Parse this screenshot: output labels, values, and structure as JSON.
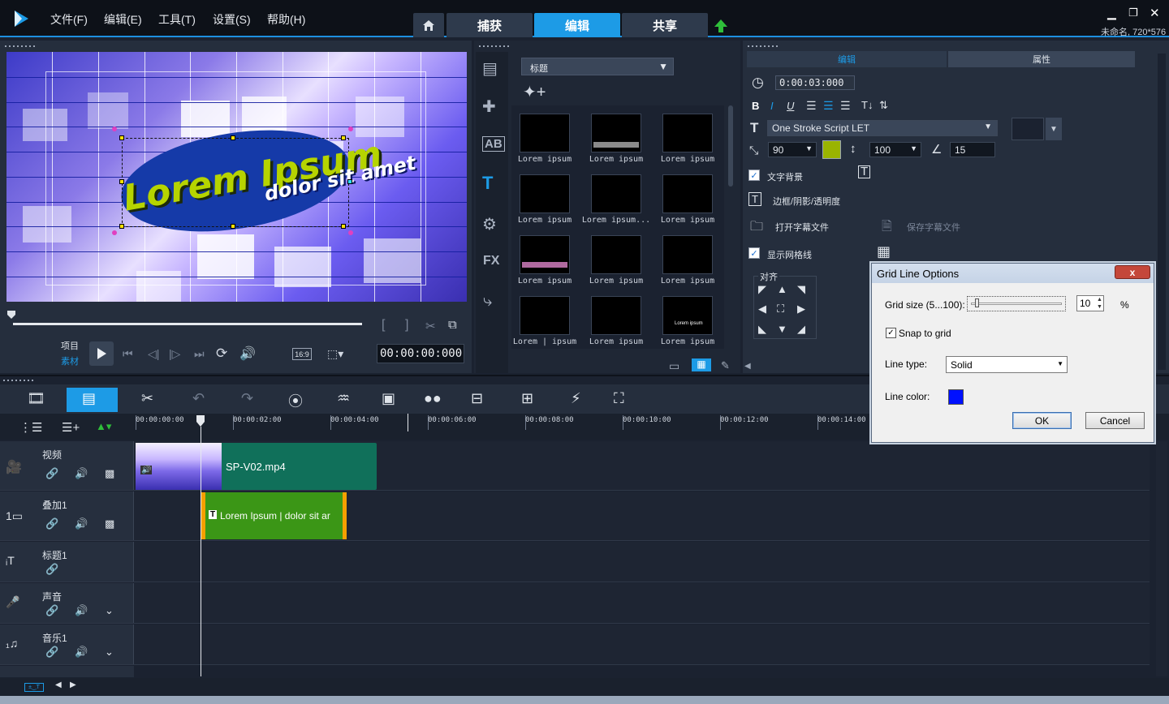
{
  "app": {
    "menu": [
      "文件(F)",
      "编辑(E)",
      "工具(T)",
      "设置(S)",
      "帮助(H)"
    ],
    "tabs": [
      "捕获",
      "编辑",
      "共享"
    ],
    "active_tab": "编辑",
    "project_info": "未命名, 720*576",
    "accent": "#1d9be6"
  },
  "preview": {
    "title_text_1": "Lorem Ipsum",
    "title_text_2": "dolor sit amet",
    "mode_project": "项目",
    "mode_clip": "素材",
    "aspect": "16:9",
    "timecode": "00:00:00:000"
  },
  "library": {
    "category": "标题",
    "items": [
      "Lorem ipsum",
      "Lorem ipsum",
      "Lorem ipsum",
      "Lorem ipsum",
      "Lorem ipsum...",
      "Lorem ipsum",
      "Lorem ipsum",
      "Lorem ipsum",
      "Lorem ipsum",
      "Lorem | ipsum",
      "Lorem ipsum",
      "Lorem ipsum"
    ],
    "fx_label": "FX",
    "thumb_mini_text": "Lorem ipsum"
  },
  "options": {
    "tab_edit": "编辑",
    "tab_attr": "属性",
    "duration": "0:00:03:000",
    "font": "One Stroke Script LET",
    "font_size": "90",
    "line_spacing": "100",
    "angle": "15",
    "text_color": "#9ab400",
    "text_bg_label": "文字背景",
    "border_label": "边框/阴影/透明度",
    "open_subtitle": "打开字幕文件",
    "save_subtitle": "保存字幕文件",
    "show_grid_label": "显示网格线",
    "align_label": "对齐"
  },
  "timeline": {
    "ruler": [
      "00:00:00:00",
      "00:00:02:00",
      "00:00:04:00",
      "00:00:06:00",
      "00:00:08:00",
      "00:00:10:00",
      "00:00:12:00",
      "00:00:14:00"
    ],
    "tracks": [
      "视频",
      "叠加1",
      "标题1",
      "声音",
      "音乐1"
    ],
    "video_clip": "SP-V02.mp4",
    "overlay_clip": "Lorem Ipsum | dolor sit ar"
  },
  "dialog": {
    "title": "Grid Line Options",
    "grid_size_label": "Grid size (5...100):",
    "grid_size_value": "10",
    "percent": "%",
    "snap_label": "Snap to grid",
    "line_type_label": "Line type:",
    "line_type_value": "Solid",
    "line_color_label": "Line color:",
    "line_color": "#0010ff",
    "ok": "OK",
    "cancel": "Cancel",
    "close": "x"
  }
}
